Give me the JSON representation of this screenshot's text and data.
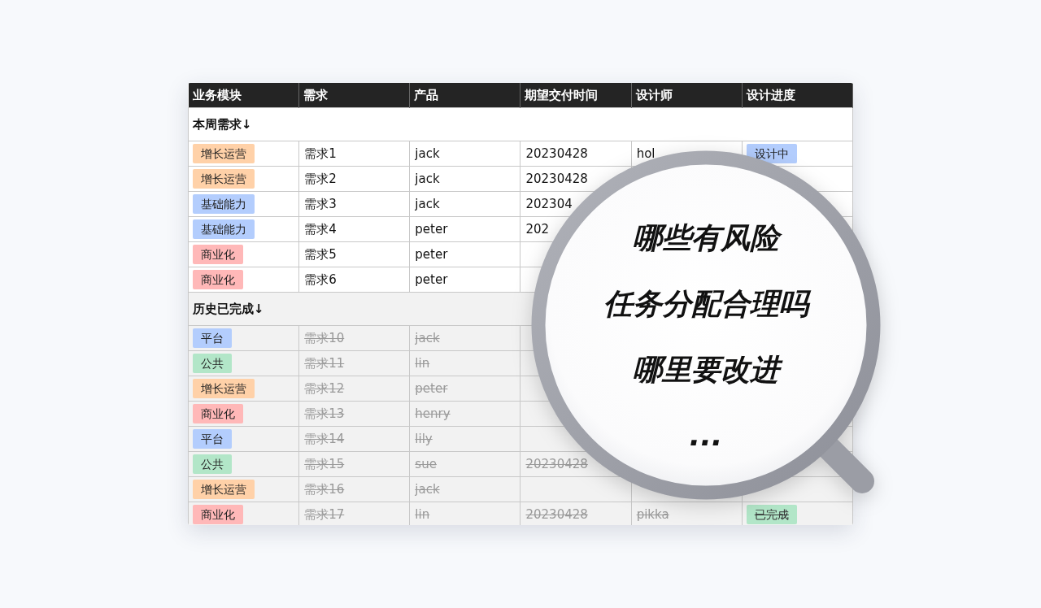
{
  "table": {
    "columns": [
      "业务模块",
      "需求",
      "产品",
      "期望交付时间",
      "设计师",
      "设计进度"
    ],
    "sections": [
      {
        "title": "本周需求↓",
        "done": false,
        "rows": [
          {
            "module": {
              "text": "增长运营",
              "color": "#ffd1a8"
            },
            "need": "需求1",
            "product": "jack",
            "date": "20230428",
            "designer": "hol",
            "status": {
              "text": "设计中",
              "color": "#b3cdfd"
            }
          },
          {
            "module": {
              "text": "增长运营",
              "color": "#ffd1a8"
            },
            "need": "需求2",
            "product": "jack",
            "date": "20230428"
          },
          {
            "module": {
              "text": "基础能力",
              "color": "#b3cdfd"
            },
            "need": "需求3",
            "product": "jack",
            "date": "202304"
          },
          {
            "module": {
              "text": "基础能力",
              "color": "#b3cdfd"
            },
            "need": "需求4",
            "product": "peter",
            "date": "202"
          },
          {
            "module": {
              "text": "商业化",
              "color": "#ffb8b8"
            },
            "need": "需求5",
            "product": "peter"
          },
          {
            "module": {
              "text": "商业化",
              "color": "#ffb8b8"
            },
            "need": "需求6",
            "product": "peter"
          }
        ]
      },
      {
        "title": "历史已完成↓",
        "done": true,
        "rows": [
          {
            "module": {
              "text": "平台",
              "color": "#b3cdfd"
            },
            "need": "需求10",
            "product": "jack"
          },
          {
            "module": {
              "text": "公共",
              "color": "#b2e6c8"
            },
            "need": "需求11",
            "product": "lin"
          },
          {
            "module": {
              "text": "增长运营",
              "color": "#ffd1a8"
            },
            "need": "需求12",
            "product": "peter"
          },
          {
            "module": {
              "text": "商业化",
              "color": "#ffb8b8"
            },
            "need": "需求13",
            "product": "henry"
          },
          {
            "module": {
              "text": "平台",
              "color": "#b3cdfd"
            },
            "need": "需求14",
            "product": "lily"
          },
          {
            "module": {
              "text": "公共",
              "color": "#b2e6c8"
            },
            "need": "需求15",
            "product": "sue",
            "date": "20230428"
          },
          {
            "module": {
              "text": "增长运营",
              "color": "#ffd1a8"
            },
            "need": "需求16",
            "product": "jack"
          },
          {
            "module": {
              "text": "商业化",
              "color": "#ffb8b8"
            },
            "need": "需求17",
            "product": "lin",
            "date": "20230428",
            "designer": "pikka",
            "status": {
              "text": "已完成",
              "color": "#b2e6c8"
            }
          }
        ]
      }
    ]
  },
  "magnifier": {
    "lines": [
      "哪些有风险",
      "任务分配合理吗",
      "哪里要改进",
      "..."
    ]
  }
}
